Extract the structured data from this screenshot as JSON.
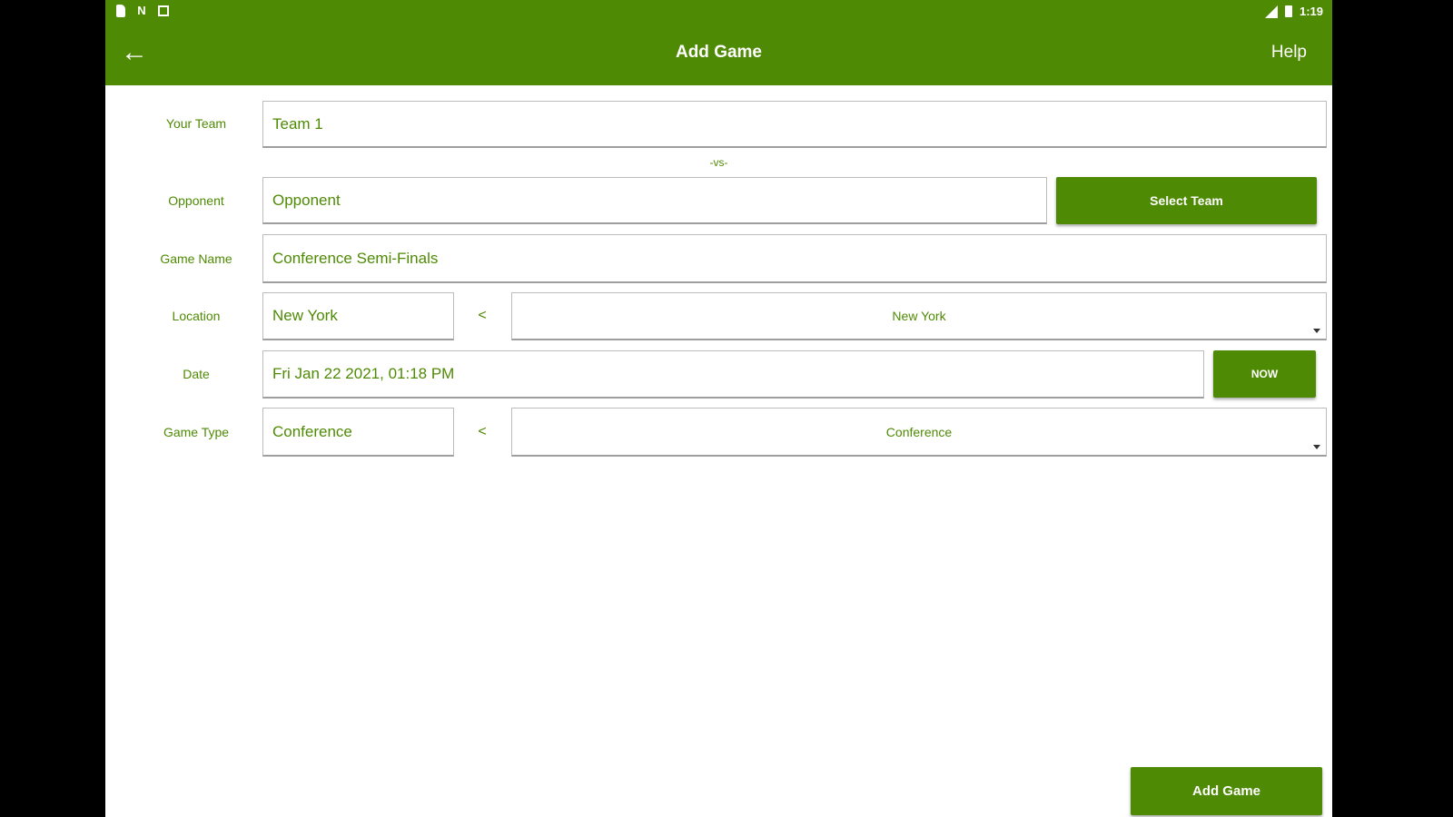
{
  "status_bar": {
    "time": "1:19",
    "left_icons": [
      "sd-card-icon",
      "n-icon",
      "box-icon"
    ],
    "right_icons": [
      "signal-icon",
      "battery-icon"
    ]
  },
  "app_bar": {
    "title": "Add Game",
    "help_label": "Help",
    "back_icon": "arrow-left-icon"
  },
  "form": {
    "your_team": {
      "label": "Your Team",
      "value": "Team 1"
    },
    "vs_label": "-vs-",
    "opponent": {
      "label": "Opponent",
      "value": "Opponent",
      "button_label": "Select Team"
    },
    "game_name": {
      "label": "Game Name",
      "value": "Conference Semi-Finals"
    },
    "location": {
      "label": "Location",
      "value": "New York",
      "separator": "<",
      "dropdown_value": "New York"
    },
    "date": {
      "label": "Date",
      "value": "Fri Jan 22 2021, 01:18 PM",
      "button_label": "NOW"
    },
    "game_type": {
      "label": "Game Type",
      "value": "Conference",
      "separator": "<",
      "dropdown_value": "Conference"
    }
  },
  "footer": {
    "add_button_label": "Add Game"
  },
  "colors": {
    "primary": "#4f8a04",
    "background": "#ffffff",
    "frame": "#000000"
  }
}
